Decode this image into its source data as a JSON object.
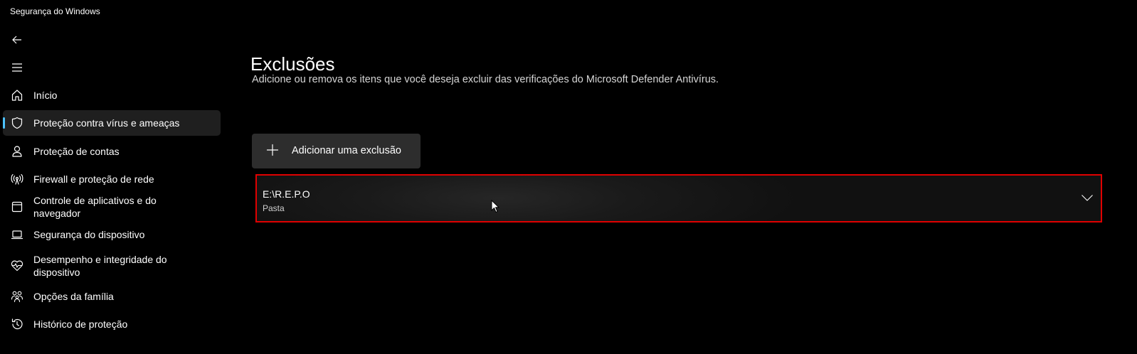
{
  "app": {
    "title": "Segurança do Windows"
  },
  "nav": {
    "items": [
      {
        "label": "Início",
        "icon": "home-icon"
      },
      {
        "label": "Proteção contra vírus e ameaças",
        "icon": "shield-icon",
        "active": true
      },
      {
        "label": "Proteção de contas",
        "icon": "person-icon"
      },
      {
        "label": "Firewall e proteção de rede",
        "icon": "antenna-icon"
      },
      {
        "label": "Controle de aplicativos e do navegador",
        "icon": "app-window-icon"
      },
      {
        "label": "Segurança do dispositivo",
        "icon": "laptop-icon"
      },
      {
        "label": "Desempenho e integridade do dispositivo",
        "icon": "heart-pulse-icon"
      },
      {
        "label": "Opções da família",
        "icon": "family-icon"
      },
      {
        "label": "Histórico de proteção",
        "icon": "history-icon"
      }
    ]
  },
  "main": {
    "title": "Exclusões",
    "description": "Adicione ou remova os itens que você deseja excluir das verificações do Microsoft Defender Antivírus.",
    "add_button_label": "Adicionar uma exclusão",
    "exclusions": [
      {
        "path": "E:\\R.E.P.O",
        "type": "Pasta"
      }
    ]
  },
  "colors": {
    "accent": "#4cc2ff",
    "highlight_border": "#e00000",
    "background": "#000000"
  }
}
